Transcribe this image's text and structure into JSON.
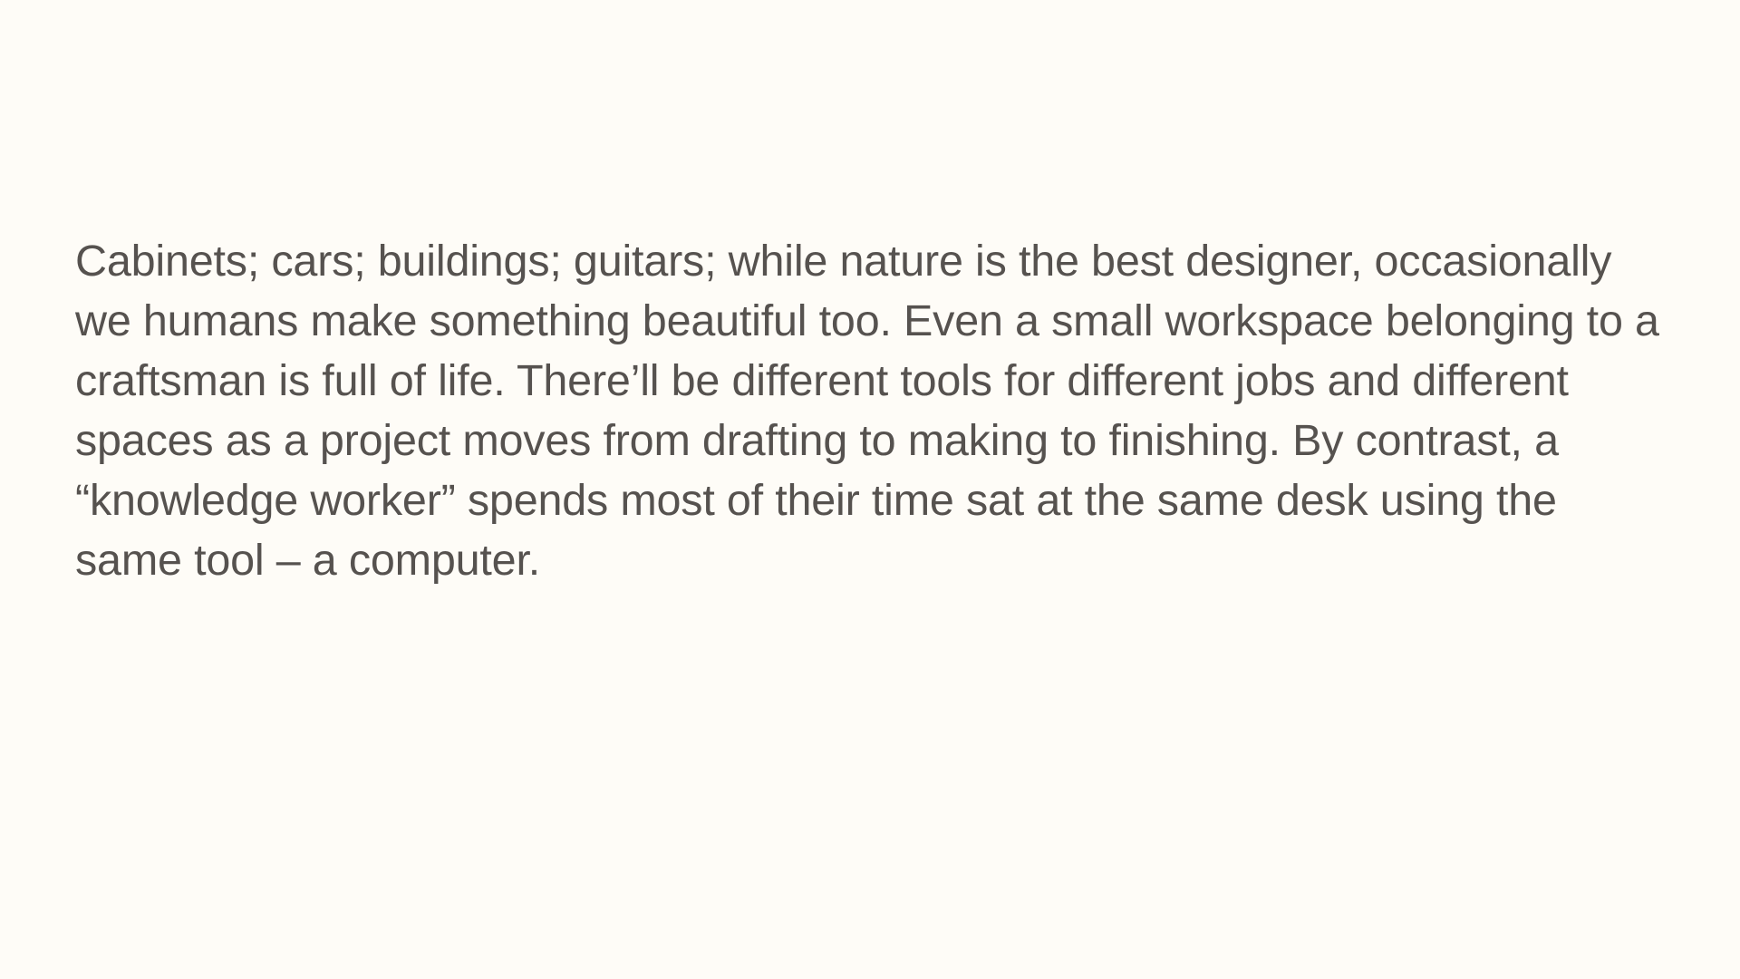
{
  "slide": {
    "background_color": "#fefcf7",
    "text_color": "#56524f",
    "paragraph_lines": [
      "Cabinets; cars; buildings; guitars; while nature is the best designer, occasionally",
      "we humans make something beautiful too. Even a small workspace belonging to a",
      "craftsman is full of life. There’ll be different tools for different jobs and different",
      "spaces as a project moves from drafting to making to finishing. By contrast, a",
      "“knowledge worker” spends most of their time sat at the same desk using the",
      "same tool – a computer."
    ]
  }
}
